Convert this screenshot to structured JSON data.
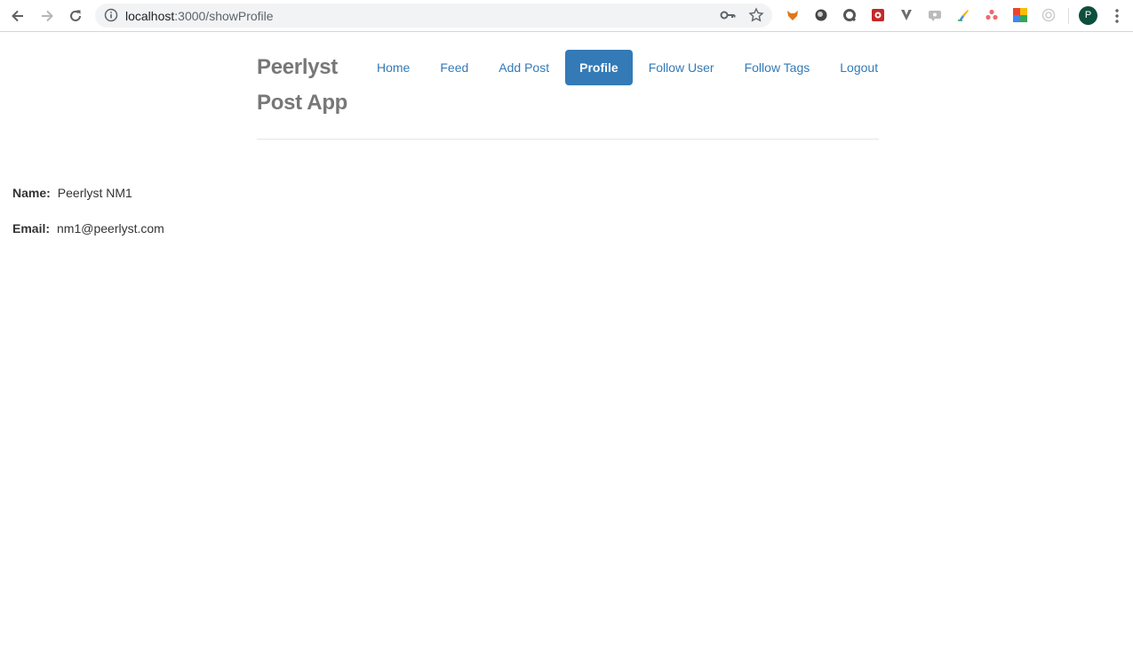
{
  "browser": {
    "url_host": "localhost",
    "url_path": ":3000/showProfile",
    "avatar_letter": "P"
  },
  "navbar": {
    "brand_line1": "Peerlyst",
    "brand_line2": "Post App",
    "items": [
      {
        "label": "Home",
        "active": false
      },
      {
        "label": "Feed",
        "active": false
      },
      {
        "label": "Add Post",
        "active": false
      },
      {
        "label": "Profile",
        "active": true
      },
      {
        "label": "Follow User",
        "active": false
      },
      {
        "label": "Follow Tags",
        "active": false
      },
      {
        "label": "Logout",
        "active": false
      }
    ]
  },
  "profile": {
    "name_label": "Name:",
    "name_value": "Peerlyst NM1",
    "email_label": "Email:",
    "email_value": "nm1@peerlyst.com"
  },
  "colors": {
    "link": "#337ab7",
    "active_bg": "#337ab7",
    "brand": "#777777",
    "avatar": "#0d4f3c"
  }
}
